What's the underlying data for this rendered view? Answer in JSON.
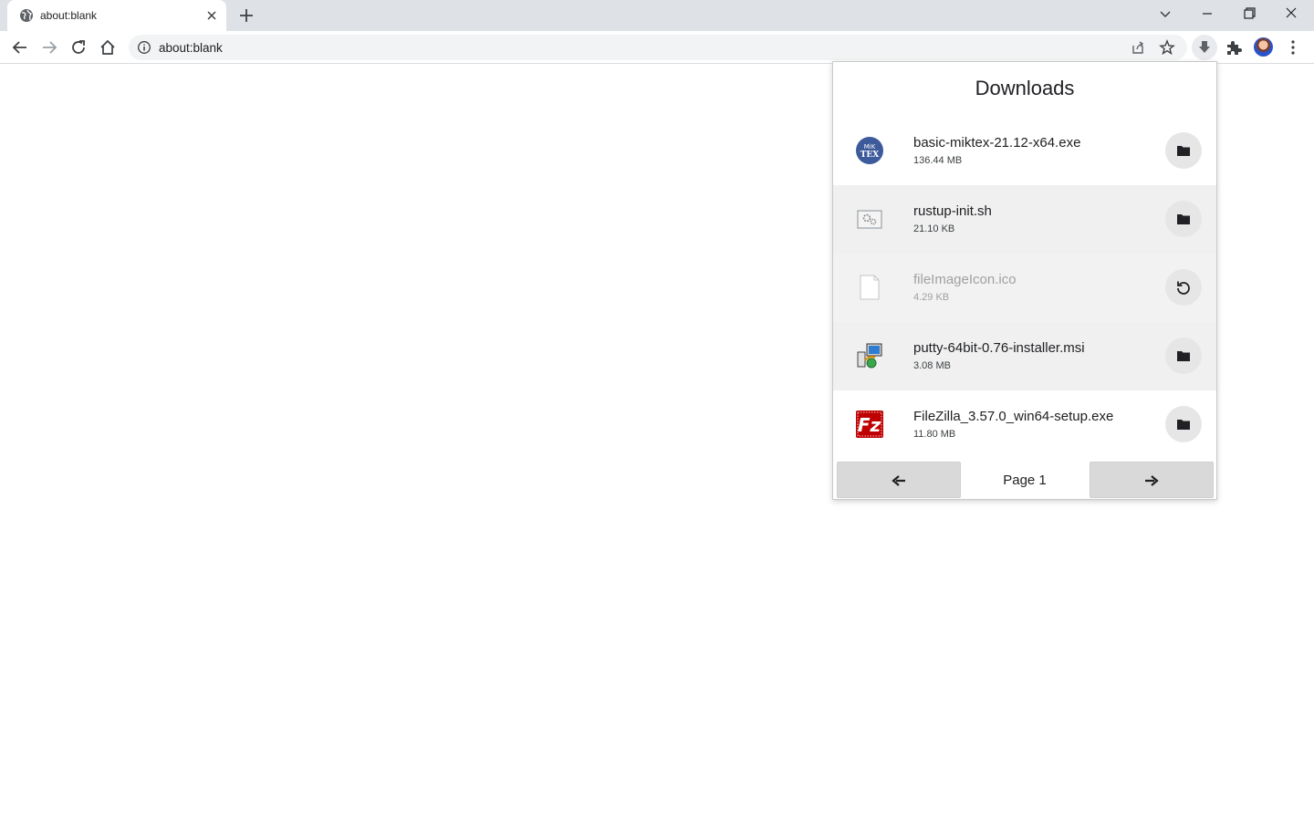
{
  "tab": {
    "title": "about:blank"
  },
  "omnibox": {
    "url": "about:blank"
  },
  "downloads": {
    "title": "Downloads",
    "items": [
      {
        "name": "basic-miktex-21.12-x64.exe",
        "size": "136.44 MB",
        "icon": "miktex-icon",
        "action": "show-in-folder",
        "status": "complete"
      },
      {
        "name": "rustup-init.sh",
        "size": "21.10 KB",
        "icon": "script-file-icon",
        "action": "show-in-folder",
        "status": "complete"
      },
      {
        "name": "fileImageIcon.ico",
        "size": "4.29 KB",
        "icon": "blank-file-icon",
        "action": "retry",
        "status": "failed"
      },
      {
        "name": "putty-64bit-0.76-installer.msi",
        "size": "3.08 MB",
        "icon": "putty-installer-icon",
        "action": "show-in-folder",
        "status": "complete"
      },
      {
        "name": "FileZilla_3.57.0_win64-setup.exe",
        "size": "11.80 MB",
        "icon": "filezilla-icon",
        "action": "show-in-folder",
        "status": "complete"
      }
    ],
    "pager": {
      "label": "Page 1"
    }
  },
  "colors": {
    "tabstrip": "#dee1e6",
    "omnibox": "#f1f3f4",
    "item_shade": "#f0f0f0",
    "action_bg": "#e6e6e6"
  }
}
